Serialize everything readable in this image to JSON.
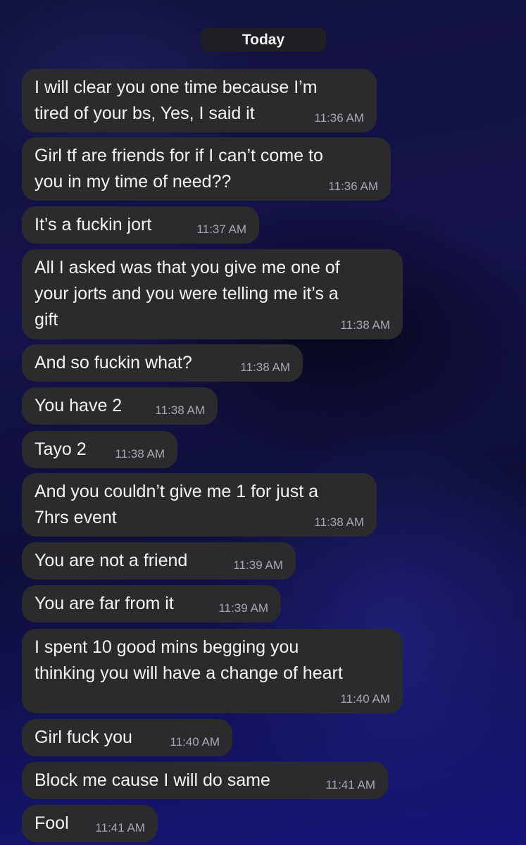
{
  "date_separator": "Today",
  "messages": [
    {
      "text": "I will clear you one time because I’m\ntired of your bs, Yes, I said it",
      "time": "11:36 AM"
    },
    {
      "text": "Girl tf are friends for if I can’t come to\nyou in my time of need??",
      "time": "11:36 AM"
    },
    {
      "text": "It’s a fuckin jort",
      "time": "11:37 AM"
    },
    {
      "text": "All I asked was that you give me one of\nyour jorts and you were telling me it’s a\ngift",
      "time": "11:38 AM"
    },
    {
      "text": "And so fuckin what?",
      "time": "11:38 AM"
    },
    {
      "text": "You have 2",
      "time": "11:38 AM"
    },
    {
      "text": "Tayo 2",
      "time": "11:38 AM"
    },
    {
      "text": "And you couldn’t give me 1 for just a\n7hrs event",
      "time": "11:38 AM"
    },
    {
      "text": "You are not a friend",
      "time": "11:39 AM"
    },
    {
      "text": "You are far from it",
      "time": "11:39 AM"
    },
    {
      "text": "I spent 10 good mins begging you\nthinking you will have a change of heart",
      "time": "11:40 AM"
    },
    {
      "text": "Girl fuck you",
      "time": "11:40 AM"
    },
    {
      "text": "Block me cause I will do same",
      "time": "11:41 AM"
    },
    {
      "text": "Fool",
      "time": "11:41 AM"
    }
  ]
}
